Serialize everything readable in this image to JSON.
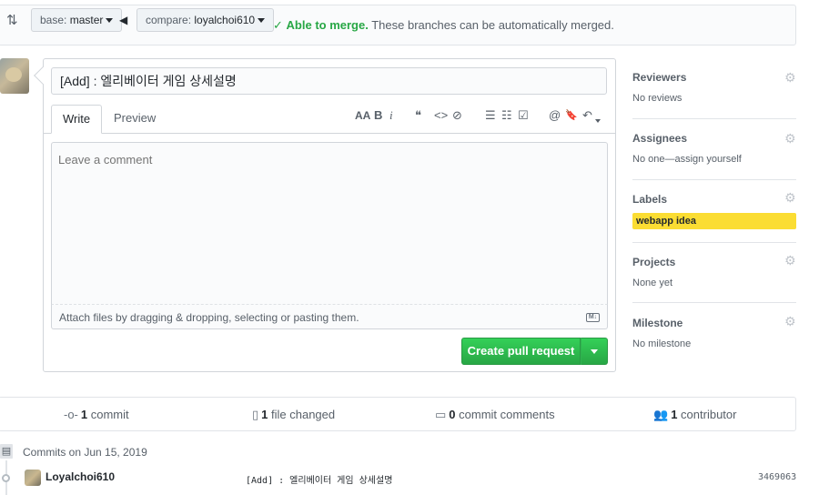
{
  "compare": {
    "base_prefix": "base:",
    "base_branch": "master",
    "compare_prefix": "compare:",
    "compare_branch": "loyalchoi610",
    "status_ok": "Able to merge.",
    "status_msg": "These branches can be automatically merged."
  },
  "composer": {
    "title_value": "[Add] : 엘리베이터 게임 상세설명",
    "tabs": [
      "Write",
      "Preview"
    ],
    "toolbar": {
      "header": "AA",
      "bold": "B",
      "italic": "i",
      "quote": "❝",
      "code": "<>",
      "link": "⊘",
      "bullet_list": "☰",
      "numbered_list": "☷",
      "task_list": "☑",
      "mention": "@",
      "reference": "🔖",
      "reply": "↶"
    },
    "comment_placeholder": "Leave a comment",
    "attach_text": "Attach files by dragging & dropping, selecting or pasting them.",
    "markdown_badge": "M↓",
    "submit_label": "Create pull request"
  },
  "sidebar": {
    "reviewers": {
      "heading": "Reviewers",
      "value": "No reviews"
    },
    "assignees": {
      "heading": "Assignees",
      "value": "No one—assign yourself"
    },
    "labels": {
      "heading": "Labels",
      "value": "webapp idea",
      "color": "#fbdd33"
    },
    "projects": {
      "heading": "Projects",
      "value": "None yet"
    },
    "milestone": {
      "heading": "Milestone",
      "value": "No milestone"
    }
  },
  "summary": {
    "commits_count": "1",
    "commits_label": "commit",
    "files_count": "1",
    "files_label": "file changed",
    "comments_count": "0",
    "comments_label": "commit comments",
    "contributors_count": "1",
    "contributors_label": "contributor"
  },
  "commits": {
    "group_label": "Commits on Jun 15, 2019",
    "items": [
      {
        "author": "Loyalchoi610",
        "message": "[Add] : 엘리베이터 게임 상세설명",
        "sha": "3469063"
      }
    ]
  },
  "colors": {
    "success": "#28a745",
    "button": "#2ea44f",
    "label": "#fbdd33"
  }
}
